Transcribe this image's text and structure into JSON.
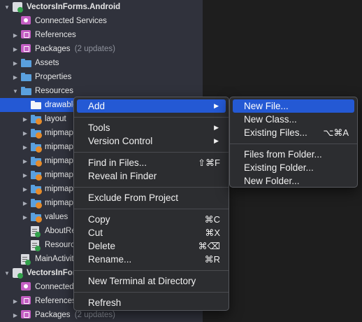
{
  "tree": [
    {
      "label": "VectorsInForms.Android",
      "indent": 0,
      "expanded": true,
      "icon": "project-icon",
      "bold": true,
      "y": 0
    },
    {
      "label": "Connected Services",
      "indent": 1,
      "icon": "connected-services-icon",
      "y": 1
    },
    {
      "label": "References",
      "indent": 1,
      "chevron": true,
      "icon": "references-icon",
      "y": 2
    },
    {
      "label": "Packages",
      "sub": "(2 updates)",
      "indent": 1,
      "chevron": true,
      "icon": "packages-icon",
      "y": 3
    },
    {
      "label": "Assets",
      "indent": 1,
      "chevron": true,
      "icon": "folder-icon",
      "y": 4
    },
    {
      "label": "Properties",
      "indent": 1,
      "chevron": true,
      "icon": "folder-icon",
      "y": 5
    },
    {
      "label": "Resources",
      "indent": 1,
      "expanded": true,
      "icon": "folder-icon",
      "y": 6
    },
    {
      "label": "drawable",
      "indent": 2,
      "icon": "folder-icon",
      "selected": true,
      "y": 7
    },
    {
      "label": "layout",
      "indent": 2,
      "chevron": true,
      "icon": "resource-folder-icon",
      "y": 8
    },
    {
      "label": "mipmap-",
      "indent": 2,
      "chevron": true,
      "icon": "resource-folder-icon",
      "y": 9
    },
    {
      "label": "mipmap-",
      "indent": 2,
      "chevron": true,
      "icon": "resource-folder-icon",
      "y": 10
    },
    {
      "label": "mipmap-",
      "indent": 2,
      "chevron": true,
      "icon": "resource-folder-icon",
      "y": 11
    },
    {
      "label": "mipmap-",
      "indent": 2,
      "chevron": true,
      "icon": "resource-folder-icon",
      "y": 12
    },
    {
      "label": "mipmap-",
      "indent": 2,
      "chevron": true,
      "icon": "resource-folder-icon",
      "y": 13
    },
    {
      "label": "mipmap-",
      "indent": 2,
      "chevron": true,
      "icon": "resource-folder-icon",
      "y": 14
    },
    {
      "label": "values",
      "indent": 2,
      "chevron": true,
      "icon": "resource-folder-icon",
      "y": 15
    },
    {
      "label": "AboutRes",
      "indent": 2,
      "icon": "text-file-icon",
      "y": 16
    },
    {
      "label": "Resource",
      "indent": 2,
      "icon": "csharp-file-icon",
      "y": 17
    },
    {
      "label": "MainActivity",
      "indent": 1,
      "icon": "csharp-file-icon",
      "y": 18
    },
    {
      "label": "VectorsInForm",
      "indent": 0,
      "expanded": true,
      "icon": "project-icon",
      "bold": true,
      "y": 19
    },
    {
      "label": "Connected",
      "indent": 1,
      "icon": "connected-services-icon",
      "y": 20
    },
    {
      "label": "References",
      "indent": 1,
      "chevron": true,
      "icon": "references-icon",
      "y": 21
    },
    {
      "label": "Packages",
      "sub": "(2 updates)",
      "indent": 1,
      "chevron": true,
      "icon": "packages-icon",
      "y": 22
    }
  ],
  "context_menu": {
    "items": [
      {
        "label": "Add",
        "submenu": true,
        "highlighted": true
      },
      {
        "separator": true
      },
      {
        "label": "Tools",
        "submenu": true
      },
      {
        "label": "Version Control",
        "submenu": true
      },
      {
        "separator": true
      },
      {
        "label": "Find in Files...",
        "shortcut": "⇧⌘F"
      },
      {
        "label": "Reveal in Finder"
      },
      {
        "separator": true
      },
      {
        "label": "Exclude From Project"
      },
      {
        "separator": true
      },
      {
        "label": "Copy",
        "shortcut": "⌘C"
      },
      {
        "label": "Cut",
        "shortcut": "⌘X"
      },
      {
        "label": "Delete",
        "shortcut": "⌘⌫"
      },
      {
        "label": "Rename...",
        "shortcut": "⌘R"
      },
      {
        "separator": true
      },
      {
        "label": "New Terminal at Directory"
      },
      {
        "separator": true
      },
      {
        "label": "Refresh"
      }
    ]
  },
  "add_submenu": {
    "items": [
      {
        "label": "New File...",
        "highlighted": true
      },
      {
        "label": "New Class..."
      },
      {
        "label": "Existing Files...",
        "shortcut": "⌥⌘A"
      },
      {
        "separator": true
      },
      {
        "label": "Files from Folder..."
      },
      {
        "label": "Existing Folder..."
      },
      {
        "label": "New Folder..."
      }
    ]
  },
  "colors": {
    "pad_bg": "#30323c",
    "selection": "#2459d4",
    "menu_bg": "#2c2d30",
    "editor_bg": "#1e1e1e"
  }
}
